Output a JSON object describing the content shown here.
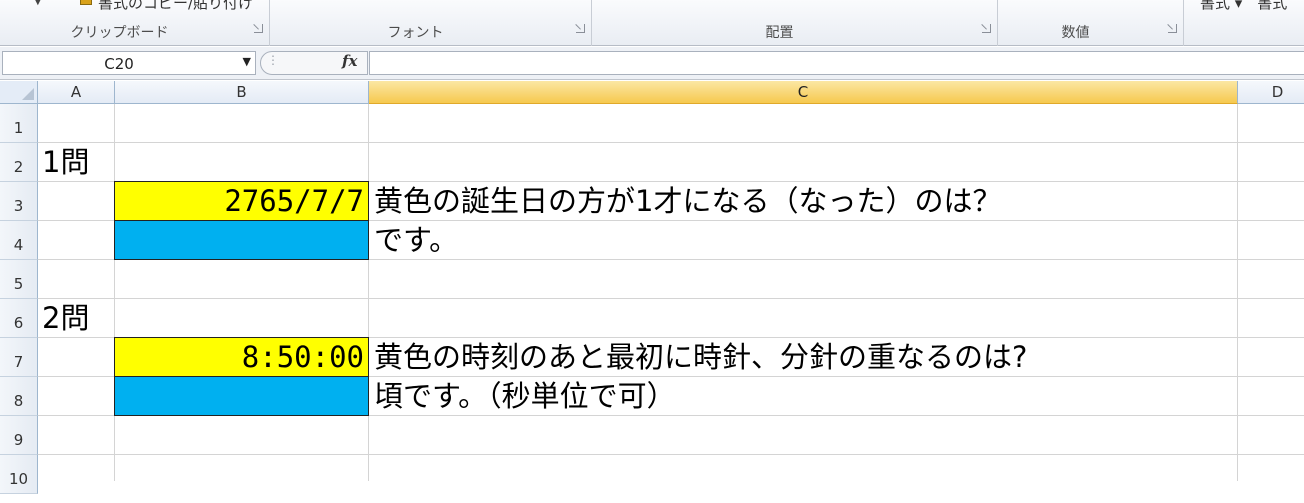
{
  "ribbon": {
    "clipboard_top": "書式のコピー/貼り付け",
    "style_top": "書式 ▾　書式",
    "groups": [
      "クリップボード",
      "フォント",
      "配置",
      "数値"
    ]
  },
  "formula_bar": {
    "name_box": "C20",
    "fx_label": "fx",
    "formula": ""
  },
  "columns": [
    "A",
    "B",
    "C",
    "D"
  ],
  "selected_column": "C",
  "rows": [
    "1",
    "2",
    "3",
    "4",
    "5",
    "6",
    "7",
    "8",
    "9",
    "10"
  ],
  "cells": {
    "A2": "1問",
    "B3": "2765/7/7",
    "C3": "黄色の誕生日の方が1才になる（なった）のは？",
    "C4": "です。",
    "A6": "2問",
    "B7": "8:50:00",
    "C7": "黄色の時刻のあと最初に時針、分針の重なるのは?",
    "C8": "頃です。（秒単位で可）"
  },
  "colors": {
    "input_cell": "#ffff00",
    "answer_cell": "#00b0f0",
    "selected_column_header": "#f6c94f"
  }
}
